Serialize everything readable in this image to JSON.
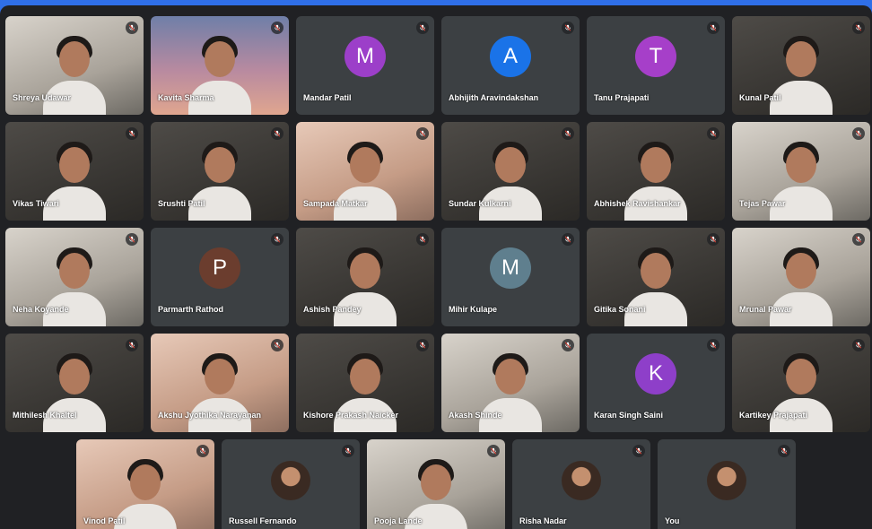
{
  "rows": [
    [
      {
        "name": "Shreya Udawar",
        "kind": "video",
        "tone": "light"
      },
      {
        "name": "Kavita Sharma",
        "kind": "video",
        "tone": "dusk"
      },
      {
        "name": "Mandar Patil",
        "kind": "letter",
        "letter": "M",
        "color": "#9c3fc9"
      },
      {
        "name": "Abhijith Aravindakshan",
        "kind": "letter",
        "letter": "A",
        "color": "#1a73e8"
      },
      {
        "name": "Tanu Prajapati",
        "kind": "letter",
        "letter": "T",
        "color": "#a63fc9"
      },
      {
        "name": "Kunal Patil",
        "kind": "video",
        "tone": "dark"
      }
    ],
    [
      {
        "name": "Vikas Tiwari",
        "kind": "video",
        "tone": "dark"
      },
      {
        "name": "Srushti Patil",
        "kind": "video",
        "tone": "dark"
      },
      {
        "name": "Sampada Matkar",
        "kind": "video",
        "tone": "warm"
      },
      {
        "name": "Sundar Kulkarni",
        "kind": "video",
        "tone": "dark"
      },
      {
        "name": "Abhishek Ravishankar",
        "kind": "video",
        "tone": "dark"
      },
      {
        "name": "Tejas Pawar",
        "kind": "video",
        "tone": "light"
      }
    ],
    [
      {
        "name": "Neha Koyande",
        "kind": "video",
        "tone": "light"
      },
      {
        "name": "Parmarth Rathod",
        "kind": "letter",
        "letter": "P",
        "color": "#6b3d2e"
      },
      {
        "name": "Ashish Pandey",
        "kind": "video",
        "tone": "dark"
      },
      {
        "name": "Mihir Kulape",
        "kind": "letter",
        "letter": "M",
        "color": "#5f7f8e"
      },
      {
        "name": "Gitika Sonani",
        "kind": "video",
        "tone": "dark"
      },
      {
        "name": "Mrunal Pawar",
        "kind": "video",
        "tone": "light"
      }
    ],
    [
      {
        "name": "Mithilesh Khaltel",
        "kind": "video",
        "tone": "dark"
      },
      {
        "name": "Akshu Jyothika Narayanan",
        "kind": "video",
        "tone": "warm"
      },
      {
        "name": "Kishore Prakash Naicker",
        "kind": "video",
        "tone": "dark"
      },
      {
        "name": "Akash Shinde",
        "kind": "video",
        "tone": "light"
      },
      {
        "name": "Karan Singh Saini",
        "kind": "letter",
        "letter": "K",
        "color": "#8e3fc9"
      },
      {
        "name": "Kartikey Prajapati",
        "kind": "video",
        "tone": "dark"
      }
    ],
    [
      {
        "name": "Vinod Patil",
        "kind": "video",
        "tone": "warm"
      },
      {
        "name": "Russell Fernando",
        "kind": "photo"
      },
      {
        "name": "Pooja Lande",
        "kind": "video",
        "tone": "light"
      },
      {
        "name": "Risha Nadar",
        "kind": "photo"
      },
      {
        "name": "You",
        "kind": "photo"
      }
    ]
  ]
}
